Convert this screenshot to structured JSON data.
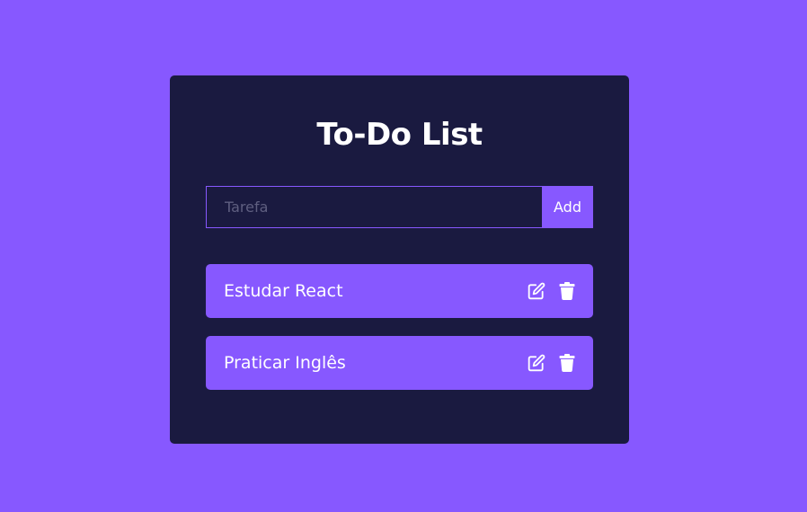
{
  "app": {
    "title": "To-Do List"
  },
  "form": {
    "placeholder": "Tarefa",
    "value": "",
    "add_label": "Add"
  },
  "todos": [
    {
      "text": "Estudar React",
      "edit_icon": "edit-icon",
      "delete_icon": "trash-icon"
    },
    {
      "text": "Praticar Inglês",
      "edit_icon": "edit-icon",
      "delete_icon": "trash-icon"
    }
  ],
  "colors": {
    "background": "#8758ff",
    "card": "#1a1a40",
    "accent": "#8758ff",
    "text": "#ffffff",
    "placeholder": "#5f5f80"
  }
}
